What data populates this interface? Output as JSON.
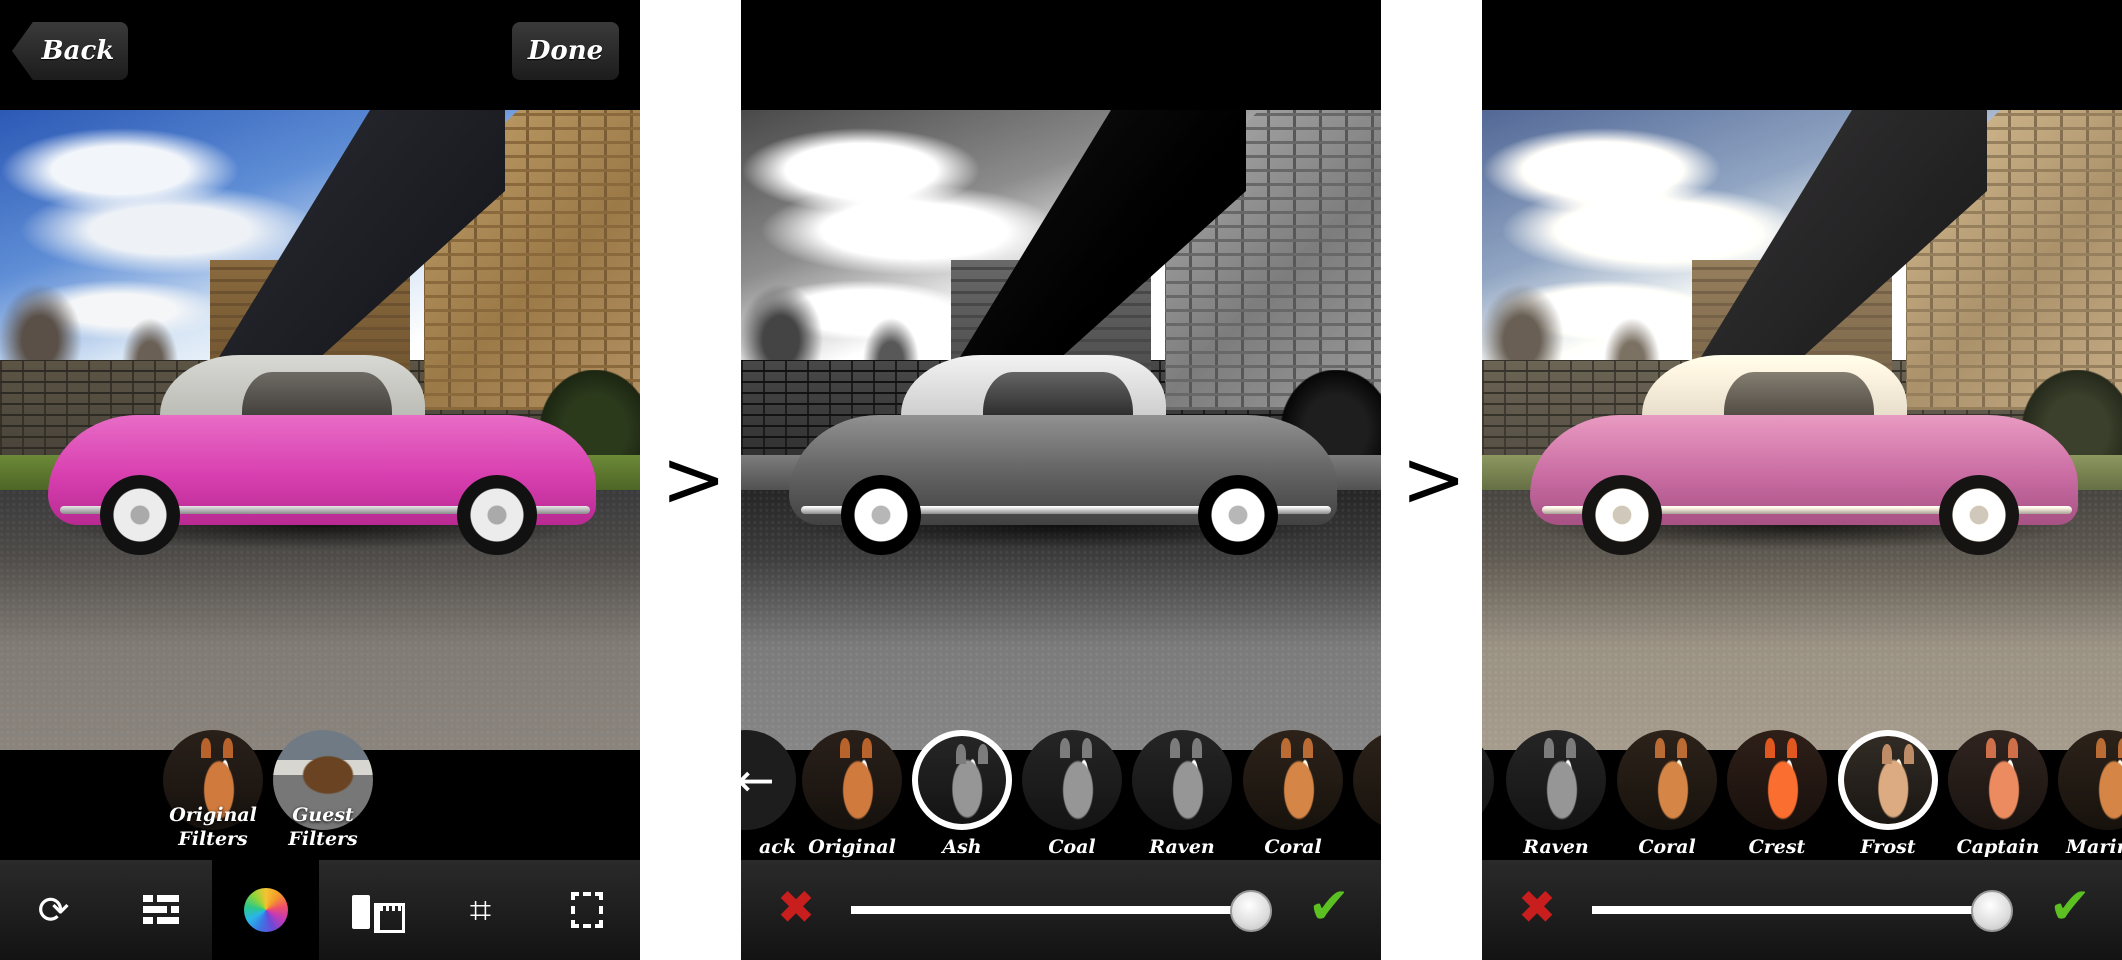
{
  "arrows": [
    ">",
    ">"
  ],
  "panel1": {
    "header": {
      "back_label": "Back",
      "done_label": "Done"
    },
    "filter_groups": [
      {
        "line1": "Original",
        "line2": "Filters",
        "image": "horse-photo"
      },
      {
        "line1": "Guest",
        "line2": "Filters",
        "image": "bison-photo"
      }
    ],
    "toolbar": [
      {
        "icon": "rotate-arrows-icon",
        "glyph": "⟳",
        "active": false
      },
      {
        "icon": "adjustments-list-icon",
        "glyph": "",
        "active": false
      },
      {
        "icon": "color-filter-wheel-icon",
        "glyph": "",
        "active": true
      },
      {
        "icon": "film-icon",
        "glyph": "",
        "active": false
      },
      {
        "icon": "rotate-crop-icon",
        "glyph": "⌗",
        "active": false
      },
      {
        "icon": "frame-border-icon",
        "glyph": "",
        "active": false
      }
    ]
  },
  "panel2": {
    "photo_filter": "Ash",
    "filters": [
      {
        "label": "Back",
        "visible_label": "ack",
        "type": "back"
      },
      {
        "label": "Original"
      },
      {
        "label": "Ash",
        "selected": true
      },
      {
        "label": "Coal"
      },
      {
        "label": "Raven"
      },
      {
        "label": "Coral"
      },
      {
        "label": "",
        "partial": true
      }
    ],
    "cancel_glyph": "✖",
    "confirm_glyph": "✔",
    "intensity": 1.0
  },
  "panel3": {
    "photo_filter": "Frost",
    "filters": [
      {
        "label": "",
        "partial": true
      },
      {
        "label": "Raven"
      },
      {
        "label": "Coral"
      },
      {
        "label": "Crest"
      },
      {
        "label": "Frost",
        "selected": true
      },
      {
        "label": "Captain"
      },
      {
        "label": "Marin",
        "visible_label": "Marin",
        "partial": true
      }
    ],
    "cancel_glyph": "✖",
    "confirm_glyph": "✔",
    "intensity": 1.0
  },
  "colors": {
    "cancel": "#c81e1e",
    "confirm": "#5cc022",
    "toolbar_bg": "#1e1e1e"
  }
}
